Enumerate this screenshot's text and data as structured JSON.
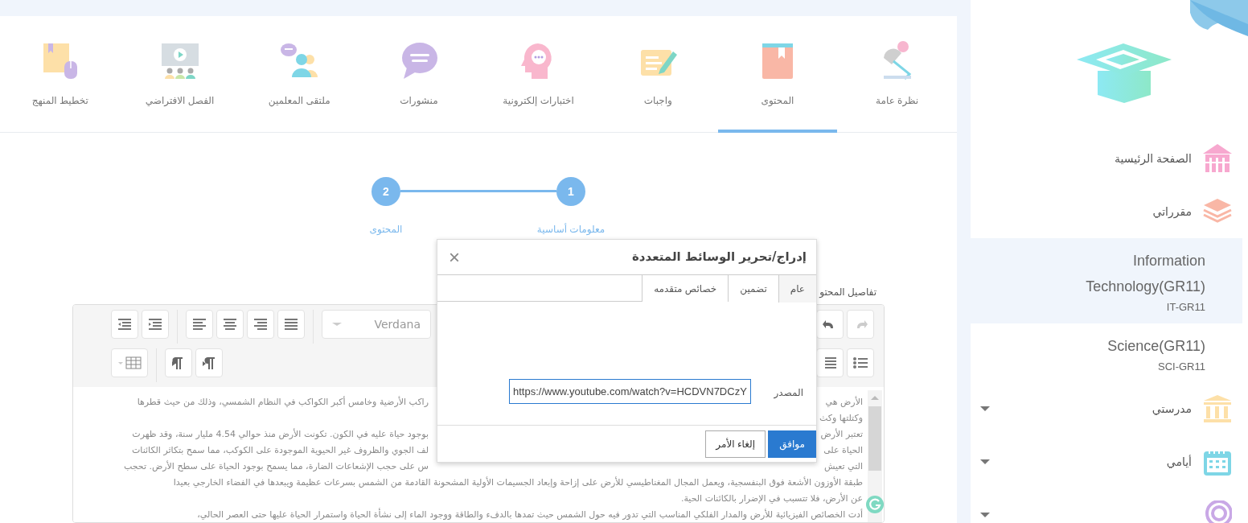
{
  "sidebar": {
    "items": [
      {
        "label": "الصفحة الرئيسية",
        "has_submenu": false
      },
      {
        "label": "مقرراتي",
        "has_submenu": false,
        "courses": [
          {
            "name": "Information Technology(GR11)",
            "code": "IT-GR11",
            "selected": true
          },
          {
            "name": "Science(GR11)",
            "code": "SCI-GR11",
            "selected": false
          }
        ]
      },
      {
        "label": "مدرستي",
        "has_submenu": true
      },
      {
        "label": "أيامي",
        "has_submenu": true
      },
      {
        "has_submenu": true
      }
    ]
  },
  "tabs": [
    {
      "label": "نظرة عامة",
      "selected": false
    },
    {
      "label": "المحتوى",
      "selected": true
    },
    {
      "label": "واجبات",
      "selected": false
    },
    {
      "label": "اختبارات إلكترونية",
      "selected": false
    },
    {
      "label": "منشورات",
      "selected": false
    },
    {
      "label": "ملتقى المعلمين",
      "selected": false
    },
    {
      "label": "الفصل الافتراضي",
      "selected": false
    },
    {
      "label": "تخطيط المنهج",
      "selected": false
    }
  ],
  "stepper": [
    {
      "number": "1",
      "label": "معلومات أساسية"
    },
    {
      "number": "2",
      "label": "المحتوى"
    }
  ],
  "content_label": "تفاصيل المحتو",
  "editor": {
    "font": "Verdana",
    "lines": [
      {
        "kind": "split",
        "right": "الأرض هي",
        "left": "راكب الأرضية وخامس أكبر الكواكب في النظام الشمسي، وذلك من حيث قطرها"
      },
      {
        "kind": "split",
        "right": "وكتلتها وكث"
      },
      {
        "kind": "split",
        "right": "تعتبر الأرض",
        "left": "بوجود حياة عليه في الكون. تكونت الأرض منذ حوالي 4.54 مليار سنة، وقد ظهرت"
      },
      {
        "kind": "split",
        "right": "الحياة على",
        "left": "لف الجوي والظروف غير الحيوية الموجودة على الكوكب، مما سمح بتكاثر الكائنات"
      },
      {
        "kind": "split",
        "right": "التي تعيش",
        "left": "س على حجب الإشعاعات الضارة، مما يسمح بوجود الحياة على سطح الأرض. تحجب"
      },
      {
        "kind": "full",
        "text": "طبقة الأوزون الأشعة فوق البنفسجية، ويعمل المجال المغناطيسي للأرض على إزاحة وإبعاد الجسيمات الأولية المشحونة القادمة من الشمس بسرعات عظيمة ويبعدها في الفضاء الخارجي بعيدا"
      },
      {
        "kind": "full",
        "text": "عن الأرض، فلا تتسبب في الإضرار بالكائنات الحية."
      },
      {
        "kind": "full",
        "text": "أدت الخصائص الفيزيائية للأرض والمدار الفلكي المناسب التي تدور فيه حول الشمس حيث تمدها بالدفء والطاقة ووجود الماء إلى نشأة الحياة واستمرار الحياة عليها حتى العصر الحالي،"
      }
    ]
  },
  "dialog": {
    "title": "إدراج/تحرير الوسائط المتعددة",
    "close": "×",
    "tabs": [
      {
        "label": "عام",
        "selected": true
      },
      {
        "label": "تضمين",
        "selected": false
      },
      {
        "label": "خصائص متقدمه",
        "selected": false
      }
    ],
    "fields": [
      {
        "label": "المصدر",
        "value": "https://www.youtube.com/watch?v=HCDVN7DCzY"
      }
    ],
    "buttons": [
      {
        "label": "موافق",
        "kind": "primary"
      },
      {
        "label": "إلغاء الأمر",
        "kind": "secondary"
      }
    ]
  }
}
